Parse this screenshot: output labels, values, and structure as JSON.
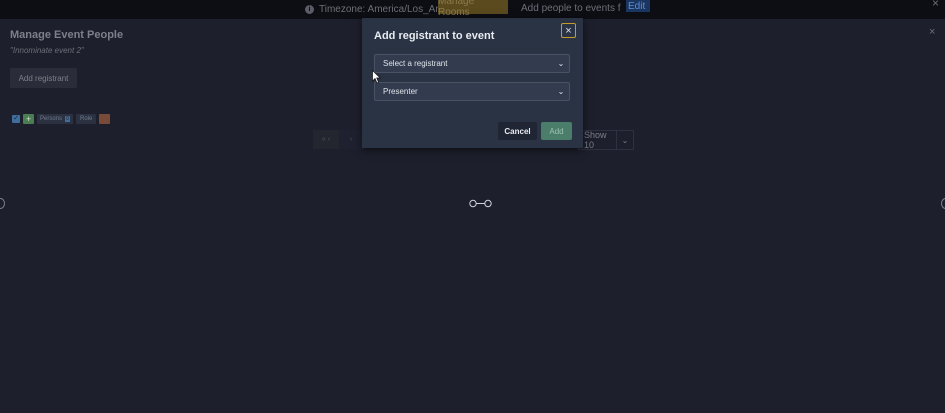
{
  "topbar": {
    "info_text": "Timezone: America/Los_Angeles",
    "rooms_label": "Manage Rooms",
    "add_people_text": "Add people to events from",
    "edit_label": "Edit",
    "close_glyph": "×"
  },
  "page": {
    "title": "Manage Event People",
    "subtitle": "\"Innominate event 2\"",
    "add_registrant_label": "Add registrant",
    "close_glyph": "×"
  },
  "filters": {
    "check_glyph": "✓",
    "plus_glyph": "+",
    "persons_label": "Persons",
    "persons_count": "0",
    "role_label": "Role"
  },
  "pagination": {
    "first_label": "« ‹",
    "prev_label": "‹",
    "show_label": "Show 10",
    "show_chevron": "⌄"
  },
  "modal": {
    "title": "Add registrant to event",
    "close_glyph": "×",
    "registrant_select": {
      "value": "Select a registrant",
      "chevron": "⌄"
    },
    "role_select": {
      "value": "Presenter",
      "chevron": "⌄"
    },
    "cancel_label": "Cancel",
    "add_label": "Add"
  },
  "colors": {
    "background": "#1d1f2c",
    "modal": "#2a3344",
    "accent_focus": "#c89a2e",
    "add_button": "#4a7d6a"
  }
}
